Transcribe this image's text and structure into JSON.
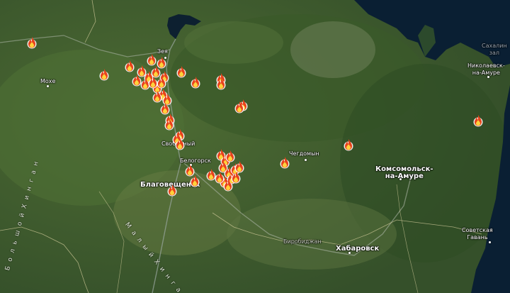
{
  "map": {
    "type": "satellite wildfire map",
    "fire_marker_icon": "fire-icon",
    "fire_marker_color": "#e8431c",
    "fire_marker_core_color": "#ffd23c",
    "land_color": "#3f5c2b",
    "sea_color": "#0a1f33"
  },
  "labels": {
    "zeya": "Зея",
    "mokhe": "Мохе",
    "svobodny": "Свободный",
    "belogorsk": "Белогорск",
    "blagoveshchensk": "Благовещенск",
    "chegdomyn": "Чегдомын",
    "komsomolsk": "Комсомольск-\nна-Амуре",
    "nikolaevsk": "Николаевск-\nна-Амуре",
    "sakhalin": "Сахалин\nзал",
    "birobidzhan": "Биробиджан",
    "khabarovsk": "Хабаровск",
    "sovetskaya_gavan": "Советская\nГавань",
    "maly_khingan": "М а л ы й   Х и н г а н",
    "bolshoy_khingan": "Б о л ь ш о й   Х и н г а н"
  },
  "fires_count": 48
}
